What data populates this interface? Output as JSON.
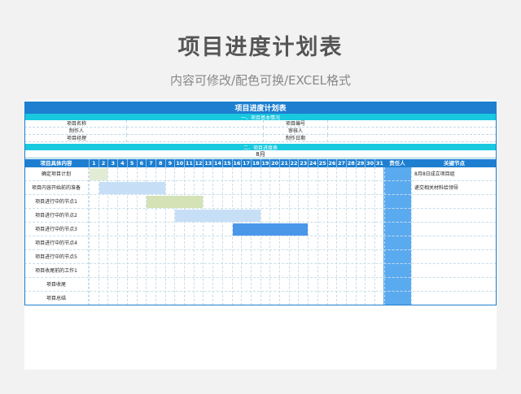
{
  "page": {
    "title": "项目进度计划表",
    "subtitle": "内容可修改/配色可换/EXCEL格式"
  },
  "sheet": {
    "title": "项目进度计划表",
    "section1": "一、项目基本情况",
    "section2": "二、项目进度表",
    "info_rows": [
      {
        "label1": "项目名称",
        "value1": "",
        "label2": "项目编号",
        "value2": ""
      },
      {
        "label1": "制作人",
        "value1": "",
        "label2": "审核人",
        "value2": ""
      },
      {
        "label1": "项目经理",
        "value1": "",
        "label2": "制作日期",
        "value2": ""
      }
    ],
    "month": "8月",
    "headers": {
      "task": "项目具体内容",
      "days": [
        "1",
        "2",
        "3",
        "4",
        "5",
        "6",
        "7",
        "8",
        "9",
        "10",
        "11",
        "12",
        "13",
        "14",
        "15",
        "16",
        "17",
        "18",
        "19",
        "20",
        "21",
        "22",
        "23",
        "24",
        "25",
        "26",
        "27",
        "28",
        "29",
        "30",
        "31"
      ],
      "owner": "责任人",
      "keypoint": "关键节点"
    },
    "tasks": [
      {
        "name": "确定项目计划",
        "start": 1,
        "end": 2,
        "color": "#e2ecd4",
        "keypoint": "8月8日成立项目组"
      },
      {
        "name": "项目内容开始前的准备",
        "start": 2,
        "end": 8,
        "color": "#c7dff6",
        "keypoint": "递交相关材料给领导"
      },
      {
        "name": "项目进行中的节点1",
        "start": 7,
        "end": 12,
        "color": "#d4e2b6",
        "keypoint": ""
      },
      {
        "name": "项目进行中的节点2",
        "start": 10,
        "end": 18,
        "color": "#c7dff6",
        "keypoint": ""
      },
      {
        "name": "项目进行中的节点3",
        "start": 16,
        "end": 23,
        "color": "#4a97ea",
        "keypoint": ""
      },
      {
        "name": "项目进行中的节点4",
        "start": 0,
        "end": 0,
        "color": "",
        "keypoint": ""
      },
      {
        "name": "项目进行中的节点5",
        "start": 0,
        "end": 0,
        "color": "",
        "keypoint": ""
      },
      {
        "name": "项目收尾前的工作1",
        "start": 0,
        "end": 0,
        "color": "",
        "keypoint": ""
      },
      {
        "name": "项目收尾",
        "start": 0,
        "end": 0,
        "color": "",
        "keypoint": ""
      },
      {
        "name": "项目总结",
        "start": 0,
        "end": 0,
        "color": "",
        "keypoint": ""
      }
    ]
  },
  "colors": {
    "header_blue": "#1e7fd0",
    "section_cyan": "#17c8df",
    "owner_column": "#5aaaf0",
    "background": "#f2f2f2"
  }
}
